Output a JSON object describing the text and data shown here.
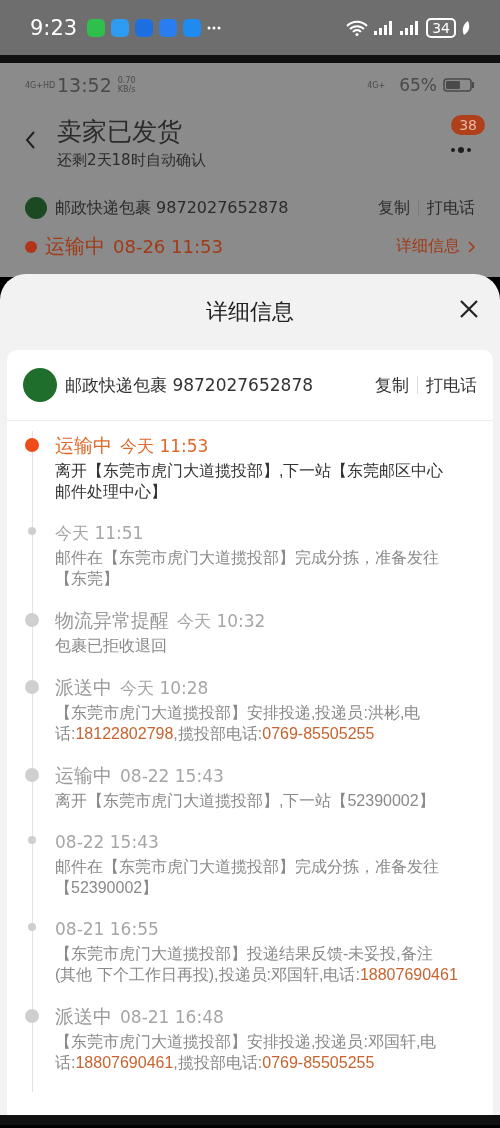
{
  "outer_status_bar": {
    "time": "9:23",
    "battery": "34"
  },
  "app_status_bar": {
    "network": "4G+HD",
    "time": "13:52",
    "speed": "0.70",
    "speed_unit": "KB/s",
    "network_right": "4G+",
    "battery": "65%"
  },
  "order_header": {
    "title": "卖家已发货",
    "subtitle": "还剩2天18时自动确认",
    "badge": "38"
  },
  "courier_row": {
    "name": "邮政快递包裹 9872027652878",
    "copy": "复制",
    "call": "打电话"
  },
  "latest_status": {
    "status": "运输中",
    "time": "08-26 11:53",
    "link": "详细信息"
  },
  "detail_sheet": {
    "title": "详细信息",
    "courier": {
      "name": "邮政快递包裹 9872027652878",
      "copy": "复制",
      "call": "打电话"
    },
    "events": [
      {
        "title": "运输中",
        "time": "今天 11:53",
        "current": true,
        "body": [
          {
            "kind": "text",
            "text": "离开【东莞市虎门大道揽投部】,下一站【东莞邮区中心邮件处理中心】"
          }
        ]
      },
      {
        "time": "今天 11:51",
        "current": false,
        "body": [
          {
            "kind": "text",
            "text": "邮件在【东莞市虎门大道揽投部】完成分拣，准备发往【东莞】"
          }
        ]
      },
      {
        "title": "物流异常提醒",
        "time": "今天 10:32",
        "current": false,
        "body": [
          {
            "kind": "text",
            "text": "包裹已拒收退回"
          }
        ]
      },
      {
        "title": "派送中",
        "time": "今天 10:28",
        "current": false,
        "body": [
          {
            "kind": "text",
            "text": "【东莞市虎门大道揽投部】安排投递,投递员:洪彬,电话:"
          },
          {
            "kind": "phone",
            "text": "18122802798"
          },
          {
            "kind": "text",
            "text": ",揽投部电话:"
          },
          {
            "kind": "phone",
            "text": "0769-85505255"
          }
        ]
      },
      {
        "title": "运输中",
        "time": "08-22 15:43",
        "current": false,
        "body": [
          {
            "kind": "text",
            "text": "离开【东莞市虎门大道揽投部】,下一站【52390002】"
          }
        ]
      },
      {
        "time": "08-22 15:43",
        "current": false,
        "body": [
          {
            "kind": "text",
            "text": "邮件在【东莞市虎门大道揽投部】完成分拣，准备发往【52390002】"
          }
        ]
      },
      {
        "time": "08-21 16:55",
        "current": false,
        "body": [
          {
            "kind": "text",
            "text": "【东莞市虎门大道揽投部】投递结果反馈-未妥投,备注"
          },
          {
            "kind": "phrase",
            "text": "(其他 下个工作日再投)"
          },
          {
            "kind": "text",
            "text": ",投递员:邓国轩,电话:"
          },
          {
            "kind": "phone",
            "text": "18807690461"
          }
        ]
      },
      {
        "title": "派送中",
        "time": "08-21 16:48",
        "current": false,
        "body": [
          {
            "kind": "text",
            "text": "【东莞市虎门大道揽投部】安排投递,投递员:邓国轩,电话:"
          },
          {
            "kind": "phone",
            "text": "18807690461"
          },
          {
            "kind": "text",
            "text": ",揽投部电话:"
          },
          {
            "kind": "phone",
            "text": "0769-85505255"
          }
        ]
      }
    ]
  }
}
